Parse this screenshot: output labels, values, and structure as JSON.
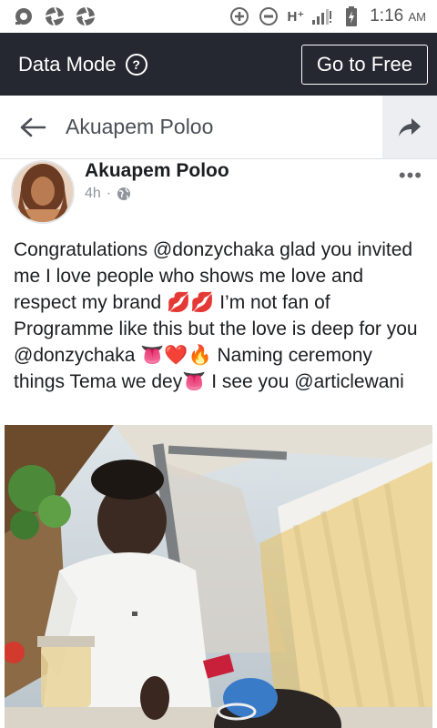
{
  "status_bar": {
    "time": "1:16",
    "ampm": "AM",
    "network": "H⁺",
    "icons": [
      "notification-icon",
      "aperture-icon",
      "aperture-icon",
      "add-circle-icon",
      "minus-circle-icon",
      "signal-icon",
      "battery-icon"
    ]
  },
  "data_bar": {
    "label": "Data Mode",
    "help_glyph": "?",
    "button": "Go to Free",
    "bg_color": "#252830"
  },
  "header": {
    "title": "Akuapem Poloo"
  },
  "post": {
    "author": "Akuapem Poloo",
    "time": "4h",
    "separator": "·",
    "more_glyph": "•••",
    "text": "Congratulations @donzychaka glad you invited me I love people who shows me love and respect my brand 💋💋 I’m not fan of Programme like this but the love is deep for you @donzychaka 👅❤️🔥 Naming ceremony things Tema we dey👅 I see you @articlewani"
  }
}
